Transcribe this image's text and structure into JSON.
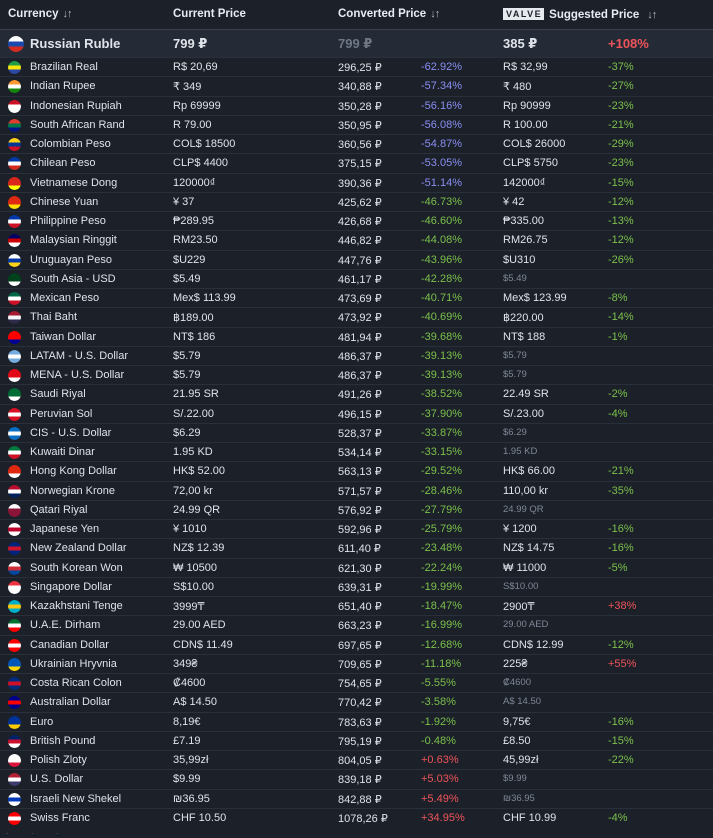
{
  "header": {
    "currency": "Currency",
    "current_price": "Current Price",
    "converted_price": "Converted Price",
    "valve_logo": "VALVE",
    "suggested_price": "Suggested Price",
    "sort_icon": "↓↑"
  },
  "base": {
    "name": "Russian Ruble",
    "current": "799 ₽",
    "converted": "799 ₽",
    "suggested": "385 ₽",
    "suggested_pct": "+108%",
    "flag": [
      "#ffffff",
      "#1c49b0",
      "#d52b1e"
    ]
  },
  "rows": [
    {
      "name": "Brazilian Real",
      "current": "R$ 20,69",
      "converted": "296,25 ₽",
      "pct": "-62.92%",
      "suggested": "R$ 32,99",
      "spct": "-37%",
      "flag": [
        "#229e45",
        "#f8e509",
        "#2b49a3"
      ]
    },
    {
      "name": "Indian Rupee",
      "current": "₹ 349",
      "converted": "340,88 ₽",
      "pct": "-57.34%",
      "suggested": "₹ 480",
      "spct": "-27%",
      "flag": [
        "#ff9933",
        "#ffffff",
        "#138808"
      ]
    },
    {
      "name": "Indonesian Rupiah",
      "current": "Rp 69999",
      "converted": "350,28 ₽",
      "pct": "-56.16%",
      "suggested": "Rp 90999",
      "spct": "-23%",
      "flag": [
        "#ce1126",
        "#ffffff",
        "#ffffff"
      ]
    },
    {
      "name": "South African Rand",
      "current": "R 79.00",
      "converted": "350,95 ₽",
      "pct": "-56.08%",
      "suggested": "R 100.00",
      "spct": "-21%",
      "flag": [
        "#e03c31",
        "#007749",
        "#001489"
      ]
    },
    {
      "name": "Colombian Peso",
      "current": "COL$ 18500",
      "converted": "360,56 ₽",
      "pct": "-54.87%",
      "suggested": "COL$ 26000",
      "spct": "-29%",
      "flag": [
        "#fcd116",
        "#003893",
        "#ce1126"
      ]
    },
    {
      "name": "Chilean Peso",
      "current": "CLP$ 4400",
      "converted": "375,15 ₽",
      "pct": "-53.05%",
      "suggested": "CLP$ 5750",
      "spct": "-23%",
      "flag": [
        "#0039a6",
        "#ffffff",
        "#d52b1e"
      ]
    },
    {
      "name": "Vietnamese Dong",
      "current": "120000₫",
      "converted": "390,36 ₽",
      "pct": "-51.14%",
      "suggested": "142000₫",
      "spct": "-15%",
      "flag": [
        "#da251d",
        "#da251d",
        "#ffff00"
      ]
    },
    {
      "name": "Chinese Yuan",
      "current": "¥ 37",
      "converted": "425,62 ₽",
      "pct": "-46.73%",
      "suggested": "¥ 42",
      "spct": "-12%",
      "flag": [
        "#de2910",
        "#de2910",
        "#ffde00"
      ]
    },
    {
      "name": "Philippine Peso",
      "current": "₱289.95",
      "converted": "426,68 ₽",
      "pct": "-46.60%",
      "suggested": "₱335.00",
      "spct": "-13%",
      "flag": [
        "#0038a8",
        "#ffffff",
        "#ce1126"
      ]
    },
    {
      "name": "Malaysian Ringgit",
      "current": "RM23.50",
      "converted": "446,82 ₽",
      "pct": "-44.08%",
      "suggested": "RM26.75",
      "spct": "-12%",
      "flag": [
        "#010066",
        "#cc0001",
        "#ffffff"
      ]
    },
    {
      "name": "Uruguayan Peso",
      "current": "$U229",
      "converted": "447,76 ₽",
      "pct": "-43.96%",
      "suggested": "$U310",
      "spct": "-26%",
      "flag": [
        "#ffffff",
        "#0038a8",
        "#fcd116"
      ]
    },
    {
      "name": "South Asia - USD",
      "current": "$5.49",
      "converted": "461,17 ₽",
      "pct": "-42.28%",
      "suggested": "$5.49",
      "spct": "",
      "dim": true,
      "flag": [
        "#01411c",
        "#01411c",
        "#ffffff"
      ]
    },
    {
      "name": "Mexican Peso",
      "current": "Mex$ 113.99",
      "converted": "473,69 ₽",
      "pct": "-40.71%",
      "suggested": "Mex$ 123.99",
      "spct": "-8%",
      "flag": [
        "#006847",
        "#ffffff",
        "#ce1126"
      ]
    },
    {
      "name": "Thai Baht",
      "current": "฿189.00",
      "converted": "473,92 ₽",
      "pct": "-40.69%",
      "suggested": "฿220.00",
      "spct": "-14%",
      "flag": [
        "#a51931",
        "#f4f5f8",
        "#2d2a4a"
      ]
    },
    {
      "name": "Taiwan Dollar",
      "current": "NT$ 186",
      "converted": "481,94 ₽",
      "pct": "-39.68%",
      "suggested": "NT$ 188",
      "spct": "-1%",
      "flag": [
        "#fe0000",
        "#fe0000",
        "#000095"
      ]
    },
    {
      "name": "LATAM - U.S. Dollar",
      "current": "$5.79",
      "converted": "486,37 ₽",
      "pct": "-39.13%",
      "suggested": "$5.79",
      "spct": "",
      "dim": true,
      "flag": [
        "#74acdf",
        "#ffffff",
        "#74acdf"
      ]
    },
    {
      "name": "MENA - U.S. Dollar",
      "current": "$5.79",
      "converted": "486,37 ₽",
      "pct": "-39.13%",
      "suggested": "$5.79",
      "spct": "",
      "dim": true,
      "flag": [
        "#e30a17",
        "#e30a17",
        "#ffffff"
      ]
    },
    {
      "name": "Saudi Riyal",
      "current": "21.95 SR",
      "converted": "491,26 ₽",
      "pct": "-38.52%",
      "suggested": "22.49 SR",
      "spct": "-2%",
      "flag": [
        "#006c35",
        "#006c35",
        "#ffffff"
      ]
    },
    {
      "name": "Peruvian Sol",
      "current": "S/.22.00",
      "converted": "496,15 ₽",
      "pct": "-37.90%",
      "suggested": "S/.23.00",
      "spct": "-4%",
      "flag": [
        "#d91023",
        "#ffffff",
        "#d91023"
      ]
    },
    {
      "name": "CIS - U.S. Dollar",
      "current": "$6.29",
      "converted": "528,37 ₽",
      "pct": "-33.87%",
      "suggested": "$6.29",
      "spct": "",
      "dim": true,
      "flag": [
        "#0b6fc4",
        "#ffffff",
        "#0b6fc4"
      ]
    },
    {
      "name": "Kuwaiti Dinar",
      "current": "1.95 KD",
      "converted": "534,14 ₽",
      "pct": "-33.15%",
      "suggested": "1.95 KD",
      "spct": "",
      "dim": true,
      "flag": [
        "#007a3d",
        "#ffffff",
        "#ce1126"
      ]
    },
    {
      "name": "Hong Kong Dollar",
      "current": "HK$ 52.00",
      "converted": "563,13 ₽",
      "pct": "-29.52%",
      "suggested": "HK$ 66.00",
      "spct": "-21%",
      "flag": [
        "#de2910",
        "#de2910",
        "#ffffff"
      ]
    },
    {
      "name": "Norwegian Krone",
      "current": "72,00 kr",
      "converted": "571,57 ₽",
      "pct": "-28.46%",
      "suggested": "110,00 kr",
      "spct": "-35%",
      "flag": [
        "#ba0c2f",
        "#ffffff",
        "#00205b"
      ]
    },
    {
      "name": "Qatari Riyal",
      "current": "24.99 QR",
      "converted": "576,92 ₽",
      "pct": "-27.79%",
      "suggested": "24.99 QR",
      "spct": "",
      "dim": true,
      "flag": [
        "#ffffff",
        "#8a1538",
        "#8a1538"
      ]
    },
    {
      "name": "Japanese Yen",
      "current": "¥ 1010",
      "converted": "592,96 ₽",
      "pct": "-25.79%",
      "suggested": "¥ 1200",
      "spct": "-16%",
      "flag": [
        "#ffffff",
        "#bc002d",
        "#ffffff"
      ]
    },
    {
      "name": "New Zealand Dollar",
      "current": "NZ$ 12.39",
      "converted": "611,40 ₽",
      "pct": "-23.48%",
      "suggested": "NZ$ 14.75",
      "spct": "-16%",
      "flag": [
        "#00247d",
        "#cc142b",
        "#00247d"
      ]
    },
    {
      "name": "South Korean Won",
      "current": "₩ 10500",
      "converted": "621,30 ₽",
      "pct": "-22.24%",
      "suggested": "₩ 11000",
      "spct": "-5%",
      "flag": [
        "#ffffff",
        "#cd2e3a",
        "#0047a0"
      ]
    },
    {
      "name": "Singapore Dollar",
      "current": "S$10.00",
      "converted": "639,31 ₽",
      "pct": "-19.99%",
      "suggested": "S$10.00",
      "spct": "",
      "dim": true,
      "flag": [
        "#ef3340",
        "#ffffff",
        "#ffffff"
      ]
    },
    {
      "name": "Kazakhstani Tenge",
      "current": "3999₸",
      "converted": "651,40 ₽",
      "pct": "-18.47%",
      "suggested": "2900₸",
      "spct": "+38%",
      "flag": [
        "#00afca",
        "#fec50c",
        "#00afca"
      ]
    },
    {
      "name": "U.A.E. Dirham",
      "current": "29.00 AED",
      "converted": "663,23 ₽",
      "pct": "-16.99%",
      "suggested": "29.00 AED",
      "spct": "",
      "dim": true,
      "flag": [
        "#00732f",
        "#ffffff",
        "#ff0000"
      ]
    },
    {
      "name": "Canadian Dollar",
      "current": "CDN$ 11.49",
      "converted": "697,65 ₽",
      "pct": "-12.68%",
      "suggested": "CDN$ 12.99",
      "spct": "-12%",
      "flag": [
        "#ff0000",
        "#ffffff",
        "#ff0000"
      ]
    },
    {
      "name": "Ukrainian Hryvnia",
      "current": "349₴",
      "converted": "709,65 ₽",
      "pct": "-11.18%",
      "suggested": "225₴",
      "spct": "+55%",
      "flag": [
        "#0057b7",
        "#0057b7",
        "#ffd700"
      ]
    },
    {
      "name": "Costa Rican Colon",
      "current": "₡4600",
      "converted": "754,65 ₽",
      "pct": "-5.55%",
      "suggested": "₡4600",
      "spct": "",
      "dim": true,
      "flag": [
        "#002b7f",
        "#ce1126",
        "#002b7f"
      ]
    },
    {
      "name": "Australian Dollar",
      "current": "A$ 14.50",
      "converted": "770,42 ₽",
      "pct": "-3.58%",
      "suggested": "A$ 14.50",
      "spct": "",
      "dim": true,
      "flag": [
        "#00008b",
        "#ff0000",
        "#00008b"
      ]
    },
    {
      "name": "Euro",
      "current": "8,19€",
      "converted": "783,63 ₽",
      "pct": "-1.92%",
      "suggested": "9,75€",
      "spct": "-16%",
      "flag": [
        "#003399",
        "#003399",
        "#ffcc00"
      ]
    },
    {
      "name": "British Pound",
      "current": "£7.19",
      "converted": "795,19 ₽",
      "pct": "-0.48%",
      "suggested": "£8.50",
      "spct": "-15%",
      "flag": [
        "#012169",
        "#c8102e",
        "#ffffff"
      ]
    },
    {
      "name": "Polish Zloty",
      "current": "35,99zł",
      "converted": "804,05 ₽",
      "pct": "+0.63%",
      "suggested": "45,99zł",
      "spct": "-22%",
      "flag": [
        "#ffffff",
        "#ffffff",
        "#dc143c"
      ]
    },
    {
      "name": "U.S. Dollar",
      "current": "$9.99",
      "converted": "839,18 ₽",
      "pct": "+5.03%",
      "suggested": "$9.99",
      "spct": "",
      "dim": true,
      "flag": [
        "#b22234",
        "#ffffff",
        "#3c3b6e"
      ]
    },
    {
      "name": "Israeli New Shekel",
      "current": "₪36.95",
      "converted": "842,88 ₽",
      "pct": "+5.49%",
      "suggested": "₪36.95",
      "spct": "",
      "dim": true,
      "flag": [
        "#ffffff",
        "#0038b8",
        "#ffffff"
      ]
    },
    {
      "name": "Swiss Franc",
      "current": "CHF 10.50",
      "converted": "1078,26 ₽",
      "pct": "+34.95%",
      "suggested": "CHF 10.99",
      "spct": "-4%",
      "flag": [
        "#ff0000",
        "#ffffff",
        "#ff0000"
      ]
    }
  ]
}
